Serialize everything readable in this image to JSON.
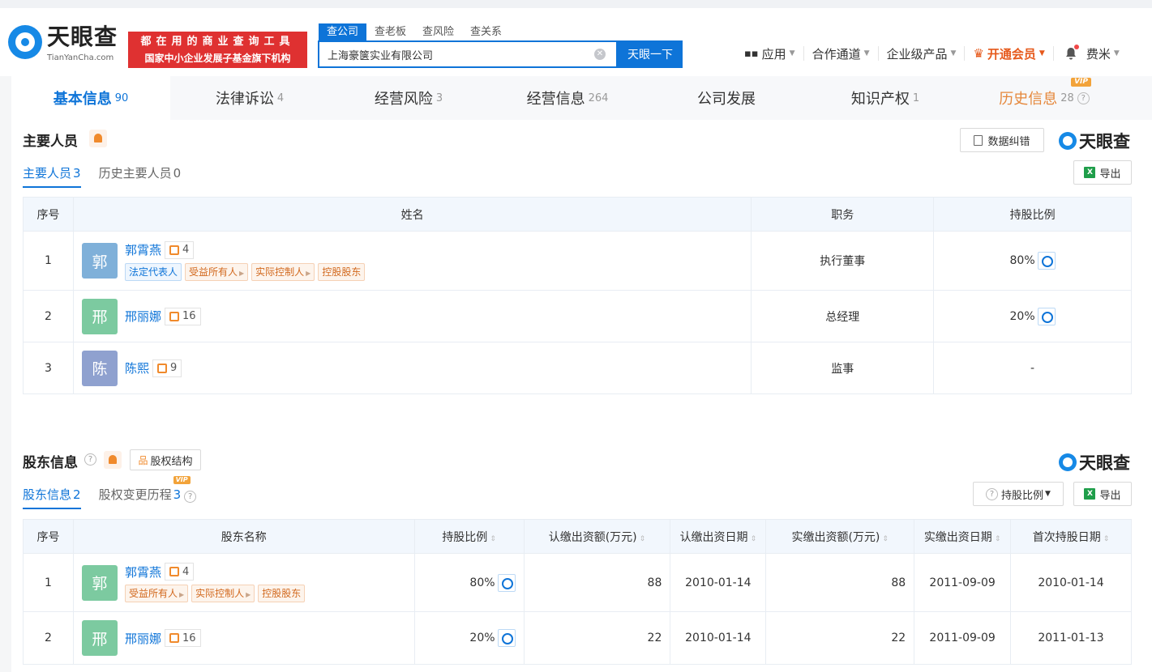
{
  "header": {
    "logo_text": "天眼查",
    "logo_sub": "TianYanCha.com",
    "slogan_line1": "都在用的商业查询工具",
    "slogan_line2": "国家中小企业发展子基金旗下机构",
    "search_tabs": [
      "查公司",
      "查老板",
      "查风险",
      "查关系"
    ],
    "search_value": "上海豪箧实业有限公司",
    "search_button": "天眼一下",
    "nav": {
      "apps": "应用",
      "partner": "合作通道",
      "enterprise": "企业级产品",
      "vip": "开通会员",
      "user": "费米"
    }
  },
  "tabs": [
    {
      "label": "基本信息",
      "count": "90"
    },
    {
      "label": "法律诉讼",
      "count": "4"
    },
    {
      "label": "经营风险",
      "count": "3"
    },
    {
      "label": "经营信息",
      "count": "264"
    },
    {
      "label": "公司发展",
      "count": ""
    },
    {
      "label": "知识产权",
      "count": "1"
    },
    {
      "label": "历史信息",
      "count": "28"
    }
  ],
  "vip_label": "VIP",
  "personnel": {
    "title": "主要人员",
    "brand": "天眼查",
    "correction_button": "数据纠错",
    "export_button": "导出",
    "subtabs": [
      {
        "label": "主要人员",
        "count": "3"
      },
      {
        "label": "历史主要人员",
        "count": "0"
      }
    ],
    "columns": [
      "序号",
      "姓名",
      "职务",
      "持股比例"
    ],
    "rows": [
      {
        "no": "1",
        "initial": "郭",
        "name": "郭霄燕",
        "relations": "4",
        "tags": [
          "法定代表人",
          "受益所有人",
          "实际控制人",
          "控股股东"
        ],
        "title": "执行董事",
        "ratio": "80%"
      },
      {
        "no": "2",
        "initial": "邢",
        "name": "邢丽娜",
        "relations": "16",
        "tags": [],
        "title": "总经理",
        "ratio": "20%"
      },
      {
        "no": "3",
        "initial": "陈",
        "name": "陈熙",
        "relations": "9",
        "tags": [],
        "title": "监事",
        "ratio": "-"
      }
    ]
  },
  "shareholders": {
    "title": "股东信息",
    "equity_button": "股权结构",
    "brand": "天眼查",
    "ratio_filter": "持股比例",
    "export_button": "导出",
    "subtabs": [
      {
        "label": "股东信息",
        "count": "2"
      },
      {
        "label": "股权变更历程",
        "count": "3"
      }
    ],
    "columns": [
      "序号",
      "股东名称",
      "持股比例",
      "认缴出资额(万元)",
      "认缴出资日期",
      "实缴出资额(万元)",
      "实缴出资日期",
      "首次持股日期"
    ],
    "rows": [
      {
        "no": "1",
        "initial": "郭",
        "name": "郭霄燕",
        "relations": "4",
        "tags": [
          "受益所有人",
          "实际控制人",
          "控股股东"
        ],
        "ratio": "80%",
        "subscribed": "88",
        "sub_date": "2010-01-14",
        "paid": "88",
        "paid_date": "2011-09-09",
        "first_date": "2010-01-14"
      },
      {
        "no": "2",
        "initial": "邢",
        "name": "邢丽娜",
        "relations": "16",
        "tags": [],
        "ratio": "20%",
        "subscribed": "22",
        "sub_date": "2010-01-14",
        "paid": "22",
        "paid_date": "2011-09-09",
        "first_date": "2011-01-13"
      }
    ]
  },
  "colors": {
    "brand_blue": "#0e74d8",
    "slogan_red": "#df3131",
    "vip_orange": "#e6591b",
    "avatar_guo_personnel": "#7fb0d9",
    "avatar_green": "#7ccaa0",
    "avatar_chen": "#8fa1cf"
  }
}
